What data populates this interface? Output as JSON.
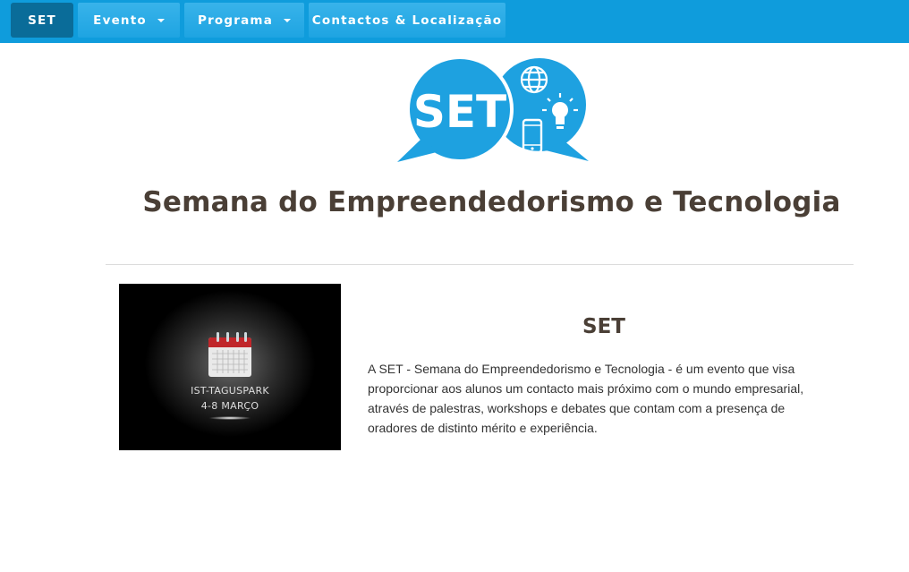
{
  "nav": {
    "brand": "SET",
    "items": [
      {
        "label": "Evento",
        "has_dropdown": true
      },
      {
        "label": "Programa",
        "has_dropdown": true
      },
      {
        "label": "Contactos & Localização",
        "has_dropdown": false
      }
    ]
  },
  "logo": {
    "text": "SET"
  },
  "site_title": "Semana do Empreendedorismo e Tecnologia",
  "event_image": {
    "place": "IST-TAGUSPARK",
    "dates": "4-8 MARÇO"
  },
  "about": {
    "heading": "SET",
    "text": "A SET - Semana do Empreendedorismo e Tecnologia - é um evento que visa proporcionar aos alunos um contacto mais próximo com o mundo empresarial, através de palestras, workshops e debates que contam com a presença de oradores de distinto mérito e experiência."
  },
  "colors": {
    "navbar": "#0f9cdc",
    "brand_bg": "#0a6c99",
    "logo_blue": "#1ea1e0",
    "heading_text": "#4a3f36"
  }
}
